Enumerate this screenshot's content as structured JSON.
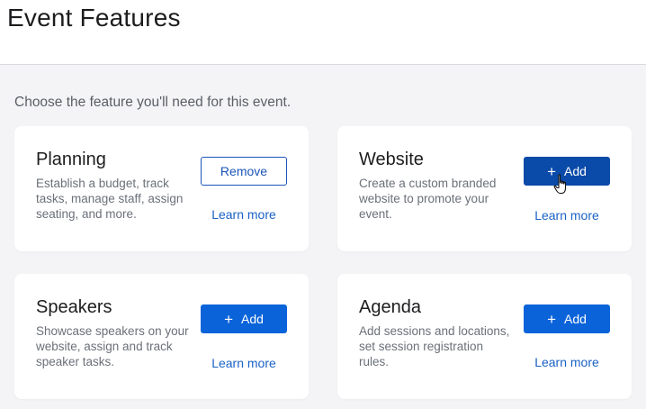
{
  "page": {
    "title": "Event Features",
    "subtitle": "Choose the feature you'll need for this event."
  },
  "cards": {
    "planning": {
      "title": "Planning",
      "description": "Establish a budget, track tasks, manage staff, assign seating, and more.",
      "button_label": "Remove",
      "learn_more": "Learn more"
    },
    "website": {
      "title": "Website",
      "description": "Create a custom branded website to promote your event.",
      "button_label": "Add",
      "learn_more": "Learn more"
    },
    "speakers": {
      "title": "Speakers",
      "description": "Showcase speakers on your website, assign and track speaker tasks.",
      "button_label": "Add",
      "learn_more": "Learn more"
    },
    "agenda": {
      "title": "Agenda",
      "description": "Add sessions and locations, set session registration rules.",
      "button_label": "Add",
      "learn_more": "Learn more"
    }
  },
  "icons": {
    "add": "plus-icon",
    "cursor": "hand-pointer-icon"
  },
  "colors": {
    "primary": "#0a63d9",
    "primary_hover": "#0a4aa8",
    "link": "#1a61c4",
    "background": "#f4f4f6"
  }
}
